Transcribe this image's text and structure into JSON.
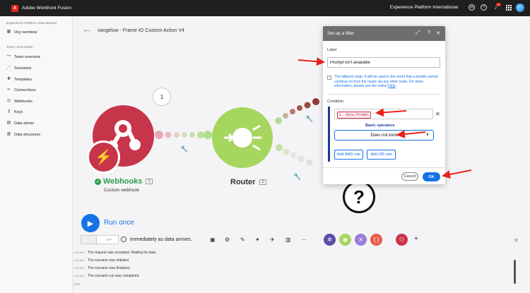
{
  "topbar": {
    "app_title": "Adobe Workfront Fusion",
    "org_name": "Experience Platform International",
    "notification_count": "9+",
    "icons": [
      "chat-icon",
      "help-icon",
      "bell-icon",
      "apps-grid-icon",
      "user-avatar"
    ]
  },
  "sidebar": {
    "org_label": "Experience Platform International",
    "org_overview": "Org overview",
    "team_label": "Team: OneAdobe",
    "items": [
      {
        "label": "Team overview",
        "icon": "chart-line-icon"
      },
      {
        "label": "Scenarios",
        "icon": "share-nodes-icon"
      },
      {
        "label": "Templates",
        "icon": "puzzle-icon"
      },
      {
        "label": "Connections",
        "icon": "link-icon"
      },
      {
        "label": "Webhooks",
        "icon": "globe-icon"
      },
      {
        "label": "Keys",
        "icon": "key-icon"
      },
      {
        "label": "Data stores",
        "icon": "database-icon"
      },
      {
        "label": "Data structures",
        "icon": "structure-icon"
      }
    ]
  },
  "canvas": {
    "scenario_title": "vangeluw - Frame IO Custom Action V4",
    "bubble_count": "1",
    "webhook_module": {
      "name": "Webhooks",
      "number": "1",
      "subtitle": "Custom webhook"
    },
    "router_module": {
      "name": "Router",
      "number": "2"
    },
    "unknown_module": {
      "symbol": "?"
    }
  },
  "bottom": {
    "run_once": "Run once",
    "toggle_state": "OFF",
    "schedule": "Immediately as data arrives.",
    "log_label": "LOG",
    "logs": [
      {
        "time": "1:19 AM",
        "text": "The request was accepted. Waiting for data."
      },
      {
        "time": "1:19 AM",
        "text": "The scenario was initiated."
      },
      {
        "time": "1:19 AM",
        "text": "The scenario was finalized."
      },
      {
        "time": "1:19 AM",
        "text": "The scenario run was completed."
      }
    ],
    "module_colors": [
      "#5c4ea8",
      "#a6d65e",
      "#9b7ed8",
      "#e85c4a",
      "#c7354b"
    ]
  },
  "dialog": {
    "title": "Set up a filter",
    "label_caption": "Label",
    "label_value": "Prompt isn't available",
    "fallback_text": "The fallback route: It will be used in the event that a bundle cannot continue on from the router via any other route. For more information, please see the online",
    "fallback_link": "Help",
    "condition_caption": "Condition",
    "condition_pill": "1. data.Prompt",
    "operators_caption": "Basic operators",
    "operator_value": "Does not exist",
    "add_and": "Add AND rule",
    "add_or": "Add OR rule",
    "cancel": "Cancel",
    "ok": "OK"
  },
  "colors": {
    "accent": "#1473e6",
    "webhook": "#c7354b",
    "router": "#a6d65e",
    "annotation": "#e8221b"
  }
}
